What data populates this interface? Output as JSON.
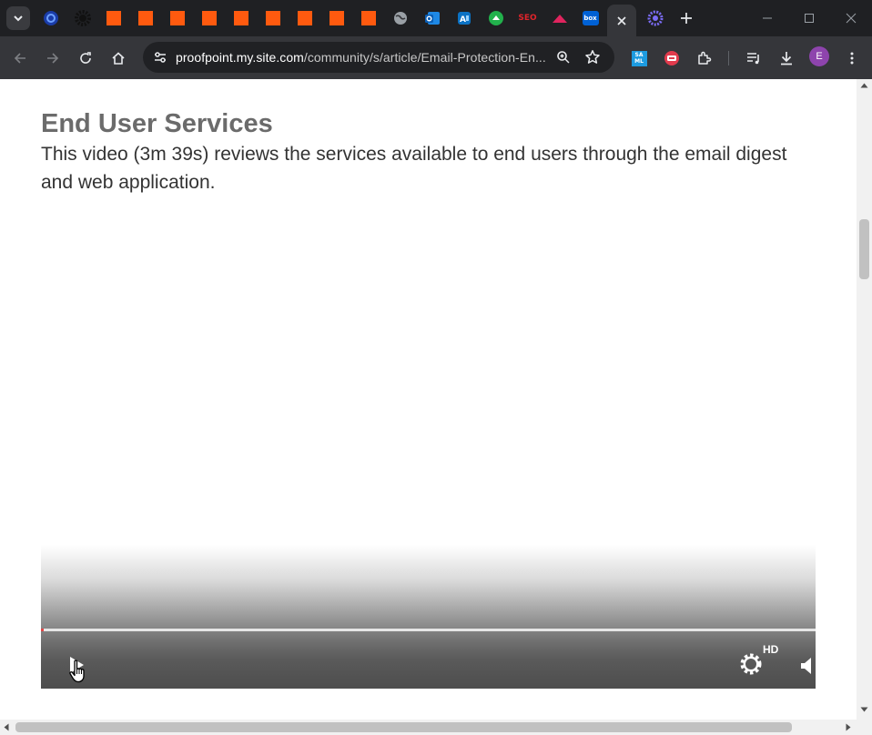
{
  "browser": {
    "tabs": [
      {
        "icon": "edge-icon"
      },
      {
        "icon": "gear-dark-icon"
      },
      {
        "icon": "orange-square-icon"
      },
      {
        "icon": "orange-square-icon"
      },
      {
        "icon": "orange-square-icon"
      },
      {
        "icon": "orange-square-icon"
      },
      {
        "icon": "orange-square-icon"
      },
      {
        "icon": "orange-square-icon"
      },
      {
        "icon": "orange-square-icon"
      },
      {
        "icon": "orange-square-icon"
      },
      {
        "icon": "orange-square-icon"
      },
      {
        "icon": "globe-icon"
      },
      {
        "icon": "outlook-icon"
      },
      {
        "icon": "translate-icon"
      },
      {
        "icon": "cloud-green-icon"
      },
      {
        "icon": "seo-icon",
        "text": "SEO"
      },
      {
        "icon": "red-mountain-icon"
      },
      {
        "icon": "box-icon",
        "text": "box"
      },
      {
        "icon": "proofpoint-active-tab-close-icon",
        "active": true
      },
      {
        "icon": "purple-flower-icon"
      }
    ],
    "address": {
      "host": "proofpoint.my.site.com",
      "path": "/community/s/article/Email-Protection-En..."
    },
    "extensions": [
      {
        "icon": "sam-icon",
        "text": "SA ML"
      },
      {
        "icon": "red-circle-extension-icon"
      },
      {
        "icon": "puzzle-icon"
      }
    ],
    "profile_initial": "E",
    "colors": {
      "tabstrip": "#1f2023",
      "toolbar": "#35363a",
      "omnibox": "#202124",
      "accent_orange": "#ff5a0f"
    }
  },
  "page": {
    "heading": "End User Services",
    "description": "This video (3m 39s) reviews the services available to end users through the email digest and web application."
  },
  "video": {
    "quality_label": "HD",
    "progress_fraction": 0.003
  }
}
